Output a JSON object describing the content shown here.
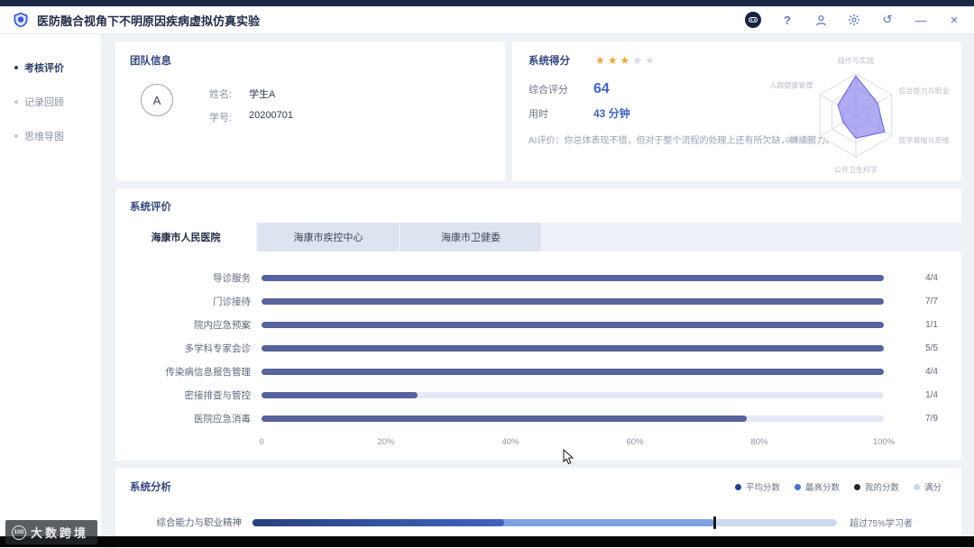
{
  "window": {
    "title": "医防融合视角下不明原因疾病虚拟仿真实验",
    "controls": {
      "help": "?",
      "undo": "↺",
      "minimize": "—",
      "close": "×"
    }
  },
  "sidebar": {
    "items": [
      {
        "label": "考核评价",
        "active": true
      },
      {
        "label": "记录回顾",
        "active": false
      },
      {
        "label": "思维导图",
        "active": false
      }
    ]
  },
  "team": {
    "title": "团队信息",
    "avatar": "A",
    "fields": [
      {
        "label": "姓名:",
        "value": "学生A"
      },
      {
        "label": "学号:",
        "value": "20200701"
      }
    ]
  },
  "score": {
    "title": "系统得分",
    "stars": 3,
    "stars_total": 5,
    "rows": [
      {
        "label": "综合评分",
        "value": "64"
      },
      {
        "label": "用时",
        "value": "43 分钟"
      }
    ],
    "ai_comment": "AI评价：你总体表现不错，但对于整个流程的处理上还有所欠缺，继续努力。",
    "radar": {
      "type": "radar",
      "axes": [
        "操作与实践",
        "综合能力与职业",
        "医学基础与思维",
        "公共卫生科学",
        "卓越控制",
        "人群健康管理"
      ],
      "values": [
        0.95,
        0.6,
        0.8,
        0.55,
        0.35,
        0.5
      ],
      "fill_color": "#7c77eb",
      "stroke_color": "#6c5fd9"
    }
  },
  "evaluation": {
    "title": "系统评价",
    "tabs": [
      {
        "label": "海康市人民医院",
        "active": true
      },
      {
        "label": "海康市疾控中心",
        "active": false
      },
      {
        "label": "海康市卫健委",
        "active": false
      }
    ],
    "chart": {
      "type": "bar",
      "categories": [
        "导诊服务",
        "门诊接待",
        "院内应急预案",
        "多学科专家会诊",
        "传染病信息报告管理",
        "密接排查与管控",
        "医院应急消毒"
      ],
      "scores": [
        "4/4",
        "7/7",
        "1/1",
        "5/5",
        "4/4",
        "1/4",
        "7/9"
      ],
      "percents": [
        100,
        100,
        100,
        100,
        100,
        25,
        78
      ],
      "ticks": [
        "0",
        "20%",
        "40%",
        "60%",
        "80%",
        "100%"
      ],
      "bar_color": "#57639c",
      "track_color": "#e3e8f5"
    }
  },
  "analysis": {
    "title": "系统分析",
    "legend": [
      {
        "label": "平均分数",
        "color": "#23418f"
      },
      {
        "label": "最高分数",
        "color": "#4a71d0"
      },
      {
        "label": "我的分数",
        "color": "#23262e"
      },
      {
        "label": "满分",
        "color": "#c9d6ef"
      }
    ],
    "rows": [
      {
        "label": "综合能力与职业精神",
        "average": 43,
        "highest": 79,
        "mine": 79,
        "full": 100,
        "note": "超过75%学习者"
      }
    ]
  },
  "watermark": {
    "logo": "100",
    "text": "大数跨境"
  }
}
